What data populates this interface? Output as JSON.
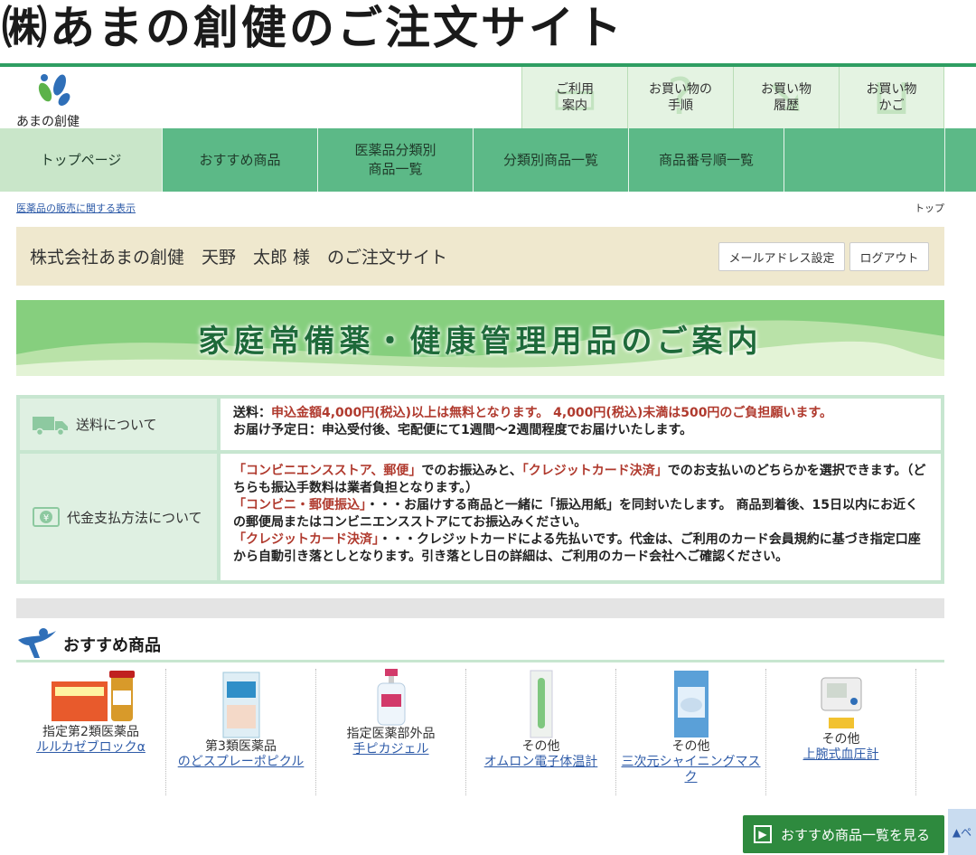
{
  "site_title": "㈱あまの創健のご注文サイト",
  "logo": {
    "text": "あまの創健"
  },
  "util_nav": [
    {
      "label": "ご利用\n案内",
      "icon": "chat-icon",
      "glyph": "▭"
    },
    {
      "label": "お買い物の\n手順",
      "icon": "question-icon",
      "glyph": "?"
    },
    {
      "label": "お買い物\n履歴",
      "icon": "history-arrow-icon",
      "glyph": "➘"
    },
    {
      "label": "お買い物\nかご",
      "icon": "basket-icon",
      "glyph": "⊔"
    }
  ],
  "main_nav": [
    {
      "label": "トップページ",
      "active": true
    },
    {
      "label": "おすすめ商品",
      "active": false
    },
    {
      "label": "医薬品分類別\n商品一覧",
      "active": false
    },
    {
      "label": "分類別商品一覧",
      "active": false
    },
    {
      "label": "商品番号順一覧",
      "active": false
    },
    {
      "label": "",
      "active": false
    }
  ],
  "crumb": {
    "left_link": "医薬品の販売に関する表示",
    "right": "トップ"
  },
  "welcome": {
    "text": "株式会社あまの創健　天野　太郎 様　のご注文サイト",
    "email_button": "メールアドレス設定",
    "logout_button": "ログアウト"
  },
  "banner": {
    "text": "家庭常備薬・健康管理用品のご案内"
  },
  "info": {
    "shipping": {
      "label": "送料について",
      "line1_prefix": "送料：",
      "line1_red": "申込金額4,000円(税込)以上は無料となります。 4,000円(税込)未満は500円のご負担願います。",
      "line2": "お届け予定日：申込受付後、宅配便にて1週間～2週間程度でお届けいたします。"
    },
    "payment": {
      "label": "代金支払方法について",
      "r1": "「コンビニエンスストア、郵便」",
      "t1": "でのお振込みと、",
      "r2": "「クレジットカード決済」",
      "t2": "でのお支払いのどちらかを選択できます。（どちらも振込手数料は業者負担となります。）",
      "r3": "「コンビニ・郵便振込」",
      "t3": "・・・お届けする商品と一緒に「振込用紙」を同封いたします。 商品到着後、15日以内にお近くの郵便局またはコンビニエンスストアにてお振込みください。",
      "r4": "「クレジットカード決済」",
      "t4": "・・・クレジットカードによる先払いです。代金は、ご利用のカード会員規約に基づき指定口座から自動引き落としとなります。引き落とし日の詳細は、ご利用のカード会社へご確認ください。"
    }
  },
  "recommend": {
    "title": "おすすめ商品",
    "more_button": "おすすめ商品一覧を見る",
    "products": [
      {
        "category": "指定第2類医薬品",
        "name": "ルルカゼブロックα",
        "img": "medicine-box-icon"
      },
      {
        "category": "第3類医薬品",
        "name": "のどスプレーポピクル",
        "img": "spray-box-icon"
      },
      {
        "category": "指定医薬部外品",
        "name": "手ピカジェル",
        "img": "gel-bottle-icon"
      },
      {
        "category": "その他",
        "name": "オムロン電子体温計",
        "img": "thermometer-icon"
      },
      {
        "category": "その他",
        "name": "三次元シャイニングマスク",
        "img": "mask-pack-icon"
      },
      {
        "category": "その他",
        "name": "上腕式血圧計",
        "img": "blood-pressure-monitor-icon"
      }
    ]
  },
  "pagetop": {
    "label": "▲ペ"
  }
}
